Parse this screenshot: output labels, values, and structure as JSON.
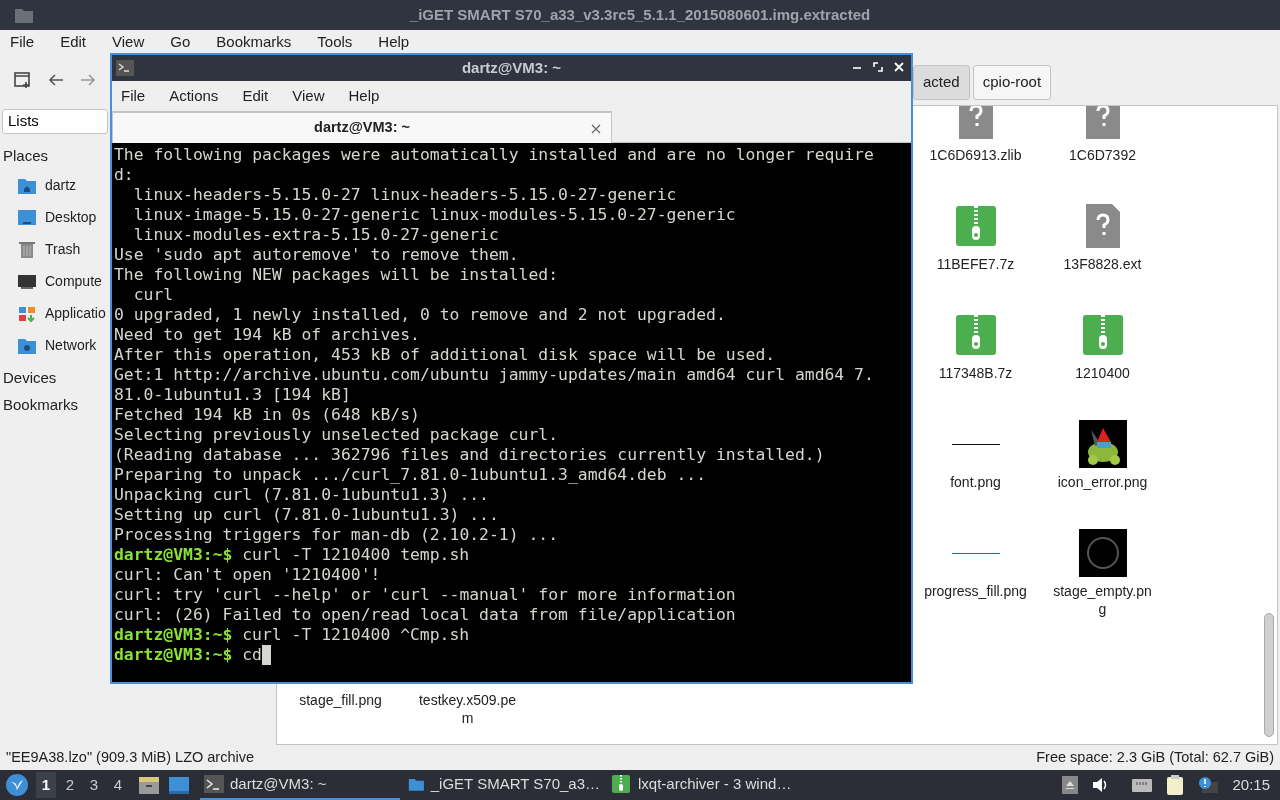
{
  "file_manager": {
    "title": "_iGET SMART S70_a33_v3.3rc5_5.1.1_2015080601.img.extracted",
    "menu": [
      "File",
      "Edit",
      "View",
      "Go",
      "Bookmarks",
      "Tools",
      "Help"
    ],
    "path_buttons": [
      {
        "label": "acted",
        "selected": true
      },
      {
        "label": "cpio-root",
        "selected": false
      }
    ],
    "side_pane": {
      "mode": "Lists",
      "sections": [
        {
          "title": "Places",
          "items": [
            {
              "label": "dartz",
              "kind": "home"
            },
            {
              "label": "Desktop",
              "kind": "desktop"
            },
            {
              "label": "Trash",
              "kind": "trash"
            },
            {
              "label": "Compute",
              "kind": "computer"
            },
            {
              "label": "Applicatio",
              "kind": "apps"
            },
            {
              "label": "Network",
              "kind": "network"
            }
          ]
        },
        {
          "title": "Devices"
        },
        {
          "title": "Bookmarks"
        }
      ]
    },
    "files": [
      {
        "name": "1C6D6913.zlib",
        "kind": "unknown"
      },
      {
        "name": "1C6D7392",
        "kind": "unknown"
      },
      {
        "name": "11BEFE7.7z",
        "kind": "archive"
      },
      {
        "name": "13F8828.ext",
        "kind": "unknown"
      },
      {
        "name": "117348B.7z",
        "kind": "archive"
      },
      {
        "name": "1210400",
        "kind": "archive"
      },
      {
        "name": "font.png",
        "kind": "line",
        "color": "#111111"
      },
      {
        "name": "icon_error.png",
        "kind": "picture"
      },
      {
        "name": "progress_fill.png",
        "kind": "line",
        "color": "#1f7a7a"
      },
      {
        "name": "stage_empty.png",
        "kind": "ring"
      }
    ],
    "files_below": [
      {
        "name": "stage_fill.png"
      },
      {
        "name": "testkey.x509.pem"
      }
    ],
    "status": "\"EE9A38.lzo\" (909.3 MiB) LZO archive",
    "free_space": "Free space: 2.3 GiB (Total: 62.7 GiB)"
  },
  "terminal": {
    "title": "dartz@VM3: ~",
    "menu": [
      "File",
      "Actions",
      "Edit",
      "View",
      "Help"
    ],
    "tabs": [
      {
        "label": "dartz@VM3: ~",
        "selected": true
      }
    ],
    "lines": [
      {
        "kind": "text",
        "text": "The following packages were automatically installed and are no longer require"
      },
      {
        "kind": "text",
        "text": "d:"
      },
      {
        "kind": "text",
        "text": "  linux-headers-5.15.0-27 linux-headers-5.15.0-27-generic"
      },
      {
        "kind": "text",
        "text": "  linux-image-5.15.0-27-generic linux-modules-5.15.0-27-generic"
      },
      {
        "kind": "text",
        "text": "  linux-modules-extra-5.15.0-27-generic"
      },
      {
        "kind": "text",
        "text": "Use 'sudo apt autoremove' to remove them."
      },
      {
        "kind": "text",
        "text": "The following NEW packages will be installed:"
      },
      {
        "kind": "text",
        "text": "  curl"
      },
      {
        "kind": "text",
        "text": "0 upgraded, 1 newly installed, 0 to remove and 2 not upgraded."
      },
      {
        "kind": "text",
        "text": "Need to get 194 kB of archives."
      },
      {
        "kind": "text",
        "text": "After this operation, 453 kB of additional disk space will be used."
      },
      {
        "kind": "text",
        "text": "Get:1 http://archive.ubuntu.com/ubuntu jammy-updates/main amd64 curl amd64 7."
      },
      {
        "kind": "text",
        "text": "81.0-1ubuntu1.3 [194 kB]"
      },
      {
        "kind": "text",
        "text": "Fetched 194 kB in 0s (648 kB/s)"
      },
      {
        "kind": "text",
        "text": "Selecting previously unselected package curl."
      },
      {
        "kind": "text",
        "text": "(Reading database ... 362796 files and directories currently installed.)"
      },
      {
        "kind": "text",
        "text": "Preparing to unpack .../curl_7.81.0-1ubuntu1.3_amd64.deb ..."
      },
      {
        "kind": "text",
        "text": "Unpacking curl (7.81.0-1ubuntu1.3) ..."
      },
      {
        "kind": "text",
        "text": "Setting up curl (7.81.0-1ubuntu1.3) ..."
      },
      {
        "kind": "text",
        "text": "Processing triggers for man-db (2.10.2-1) ..."
      },
      {
        "kind": "prompt",
        "prompt": "dartz@VM3:~$",
        "command": "curl -T 1210400 temp.sh"
      },
      {
        "kind": "text",
        "text": "curl: Can't open '1210400'!"
      },
      {
        "kind": "text",
        "text": "curl: try 'curl --help' or 'curl --manual' for more information"
      },
      {
        "kind": "text",
        "text": "curl: (26) Failed to open/read local data from file/application"
      },
      {
        "kind": "prompt",
        "prompt": "dartz@VM3:~$",
        "command": "curl -T 1210400 ^Cmp.sh"
      },
      {
        "kind": "prompt",
        "prompt": "dartz@VM3:~$",
        "command": "cd",
        "cursor": true
      }
    ]
  },
  "taskbar": {
    "desktops": [
      {
        "label": "1",
        "selected": true
      },
      {
        "label": "2",
        "selected": false
      },
      {
        "label": "3",
        "selected": false
      },
      {
        "label": "4",
        "selected": false
      }
    ],
    "tasks": [
      {
        "label": "dartz@VM3: ~",
        "kind": "terminal",
        "selected": true
      },
      {
        "label": "_iGET SMART S70_a3…",
        "kind": "folder",
        "selected": false
      },
      {
        "label": "lxqt-archiver - 3 wind…",
        "kind": "archive",
        "selected": false
      }
    ],
    "clock": "20:15"
  }
}
